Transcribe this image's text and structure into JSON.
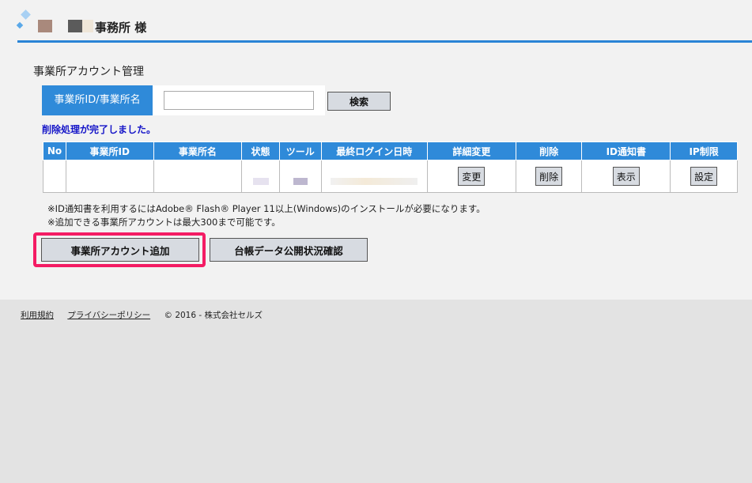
{
  "header": {
    "title": "事務所 様"
  },
  "page": {
    "section_title": "事業所アカウント管理"
  },
  "search": {
    "label": "事業所ID/事業所名",
    "value": "",
    "button_label": "検索"
  },
  "status_message": "削除処理が完了しました。",
  "table": {
    "columns": [
      "No",
      "事業所ID",
      "事業所名",
      "状態",
      "ツール",
      "最終ログイン日時",
      "詳細変更",
      "削除",
      "ID通知書",
      "IP制限"
    ],
    "row_buttons": {
      "edit": "変更",
      "delete": "削除",
      "show": "表示",
      "setting": "設定"
    }
  },
  "notes": [
    "※ID通知書を利用するにはAdobe® Flash® Player 11以上(Windows)のインストールが必要になります。",
    "※追加できる事業所アカウントは最大300まで可能です。"
  ],
  "actions": {
    "add_account": "事業所アカウント追加",
    "ledger_status": "台帳データ公開状況確認"
  },
  "footer": {
    "terms": "利用規約",
    "privacy": "プライバシーポリシー",
    "copyright": "© 2016 - 株式会社セルズ"
  },
  "colors": {
    "accent": "#2f8ad9",
    "highlight": "#f41c64",
    "status_text": "#1414c8"
  }
}
